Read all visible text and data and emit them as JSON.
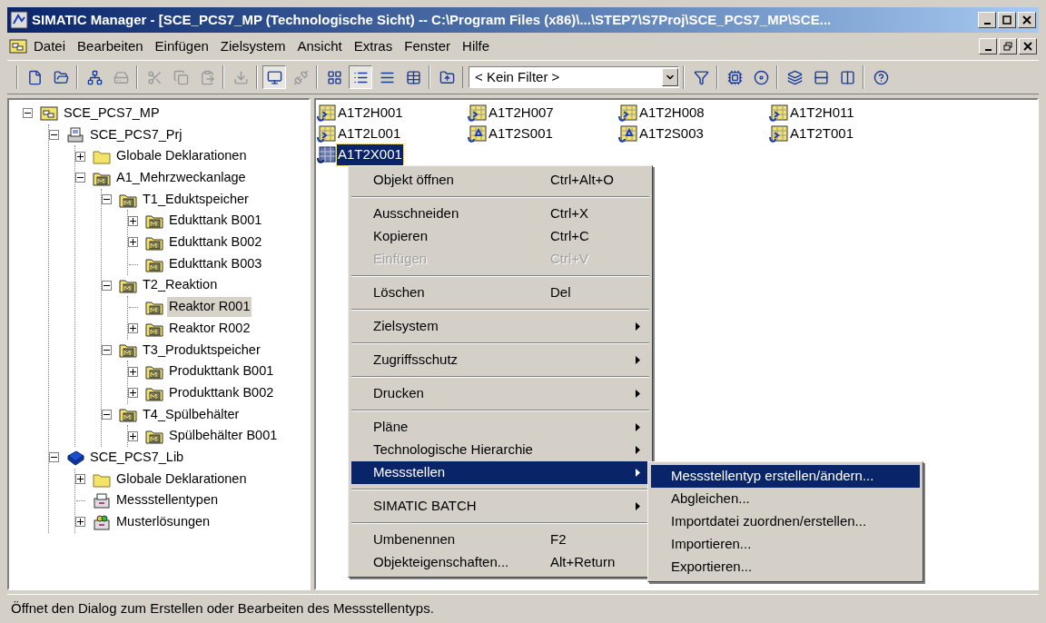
{
  "window": {
    "title": "SIMATIC Manager - [SCE_PCS7_MP (Technologische Sicht) -- C:\\Program Files (x86)\\...\\STEP7\\S7Proj\\SCE_PCS7_MP\\SCE..."
  },
  "menu_bar": {
    "items": [
      "Datei",
      "Bearbeiten",
      "Einfügen",
      "Zielsystem",
      "Ansicht",
      "Extras",
      "Fenster",
      "Hilfe"
    ]
  },
  "toolbar": {
    "groups": [
      [
        {
          "kind": "new",
          "disabled": false,
          "pressed": false
        },
        {
          "kind": "open",
          "disabled": false,
          "pressed": false
        }
      ],
      [
        {
          "kind": "network",
          "disabled": false,
          "pressed": false
        },
        {
          "kind": "hardware",
          "disabled": true,
          "pressed": false
        }
      ],
      [
        {
          "kind": "cut",
          "disabled": true,
          "pressed": false
        },
        {
          "kind": "copy",
          "disabled": true,
          "pressed": false
        },
        {
          "kind": "paste",
          "disabled": true,
          "pressed": false
        }
      ],
      [
        {
          "kind": "download",
          "disabled": true,
          "pressed": false
        }
      ],
      [
        {
          "kind": "online",
          "disabled": false,
          "pressed": true
        },
        {
          "kind": "offline",
          "disabled": true,
          "pressed": false
        }
      ],
      [
        {
          "kind": "large-icons",
          "disabled": false,
          "pressed": false
        },
        {
          "kind": "small-icons",
          "disabled": false,
          "pressed": true
        },
        {
          "kind": "list",
          "disabled": false,
          "pressed": false
        },
        {
          "kind": "details",
          "disabled": false,
          "pressed": false
        }
      ],
      [
        {
          "kind": "up",
          "disabled": false,
          "pressed": false
        }
      ]
    ],
    "filter": {
      "value": "< Kein Filter >"
    },
    "groups_right": [
      [
        {
          "kind": "filter",
          "disabled": false,
          "pressed": false
        }
      ],
      [
        {
          "kind": "accessible",
          "disabled": false,
          "pressed": false
        },
        {
          "kind": "simulation",
          "disabled": false,
          "pressed": false
        }
      ],
      [
        {
          "kind": "cascade",
          "disabled": false,
          "pressed": false
        },
        {
          "kind": "tile-h",
          "disabled": false,
          "pressed": false
        },
        {
          "kind": "tile-v",
          "disabled": false,
          "pressed": false
        }
      ],
      [
        {
          "kind": "help",
          "disabled": false,
          "pressed": false
        }
      ]
    ]
  },
  "tree": [
    {
      "label": "SCE_PCS7_MP",
      "kind": "multiproject",
      "expanded": true,
      "selected": false,
      "children": [
        {
          "label": "SCE_PCS7_Prj",
          "kind": "project",
          "expanded": true,
          "selected": false,
          "children": [
            {
              "label": "Globale Deklarationen",
              "kind": "folder",
              "expanded": false,
              "selected": false
            },
            {
              "label": "A1_Mehrzweckanlage",
              "kind": "plant",
              "expanded": true,
              "selected": false,
              "children": [
                {
                  "label": "T1_Eduktspeicher",
                  "kind": "plant",
                  "expanded": true,
                  "selected": false,
                  "children": [
                    {
                      "label": "Edukttank B001",
                      "kind": "plant",
                      "expanded": false,
                      "selected": false
                    },
                    {
                      "label": "Edukttank B002",
                      "kind": "plant",
                      "expanded": false,
                      "selected": false
                    },
                    {
                      "label": "Edukttank B003",
                      "kind": "plant",
                      "selected": false
                    }
                  ]
                },
                {
                  "label": "T2_Reaktion",
                  "kind": "plant",
                  "expanded": true,
                  "selected": false,
                  "children": [
                    {
                      "label": "Reaktor R001",
                      "kind": "plant",
                      "selected": true
                    },
                    {
                      "label": "Reaktor R002",
                      "kind": "plant",
                      "expanded": false,
                      "selected": false
                    }
                  ]
                },
                {
                  "label": "T3_Produktspeicher",
                  "kind": "plant",
                  "expanded": true,
                  "selected": false,
                  "children": [
                    {
                      "label": "Produkttank B001",
                      "kind": "plant",
                      "expanded": false,
                      "selected": false
                    },
                    {
                      "label": "Produkttank B002",
                      "kind": "plant",
                      "expanded": false,
                      "selected": false
                    }
                  ]
                },
                {
                  "label": "T4_Spülbehälter",
                  "kind": "plant",
                  "expanded": true,
                  "selected": false,
                  "children": [
                    {
                      "label": "Spülbehälter B001",
                      "kind": "plant",
                      "expanded": false,
                      "selected": false
                    }
                  ]
                }
              ]
            }
          ]
        },
        {
          "label": "SCE_PCS7_Lib",
          "kind": "library",
          "expanded": true,
          "selected": false,
          "children": [
            {
              "label": "Globale Deklarationen",
              "kind": "folder",
              "expanded": false,
              "selected": false
            },
            {
              "label": "Messstellentypen",
              "kind": "archive",
              "selected": false
            },
            {
              "label": "Musterlösungen",
              "kind": "archive-green",
              "expanded": false,
              "selected": false
            }
          ]
        }
      ]
    }
  ],
  "objects": [
    {
      "label": "A1T2H001",
      "kind": "chart",
      "selected": false
    },
    {
      "label": "A1T2H007",
      "kind": "chart",
      "selected": false
    },
    {
      "label": "A1T2H008",
      "kind": "chart",
      "selected": false
    },
    {
      "label": "A1T2H011",
      "kind": "chart",
      "selected": false
    },
    {
      "label": "A1T2L001",
      "kind": "chart",
      "selected": false
    },
    {
      "label": "A1T2S001",
      "kind": "chart-blue",
      "selected": false
    },
    {
      "label": "A1T2S003",
      "kind": "chart-blue",
      "selected": false
    },
    {
      "label": "A1T2T001",
      "kind": "chart",
      "selected": false
    },
    {
      "label": "A1T2X001",
      "kind": "type",
      "selected": true
    }
  ],
  "context_menu": {
    "sections": [
      [
        {
          "label": "Objekt öffnen",
          "shortcut": "Ctrl+Alt+O",
          "submenu": false,
          "disabled": false,
          "selected": false
        }
      ],
      [
        {
          "label": "Ausschneiden",
          "shortcut": "Ctrl+X",
          "submenu": false,
          "disabled": false,
          "selected": false
        },
        {
          "label": "Kopieren",
          "shortcut": "Ctrl+C",
          "submenu": false,
          "disabled": false,
          "selected": false
        },
        {
          "label": "Einfügen",
          "shortcut": "Ctrl+V",
          "submenu": false,
          "disabled": true,
          "selected": false
        }
      ],
      [
        {
          "label": "Löschen",
          "shortcut": "Del",
          "submenu": false,
          "disabled": false,
          "selected": false
        }
      ],
      [
        {
          "label": "Zielsystem",
          "submenu": true,
          "disabled": false,
          "selected": false
        }
      ],
      [
        {
          "label": "Zugriffsschutz",
          "submenu": true,
          "disabled": false,
          "selected": false
        }
      ],
      [
        {
          "label": "Drucken",
          "submenu": true,
          "disabled": false,
          "selected": false
        }
      ],
      [
        {
          "label": "Pläne",
          "submenu": true,
          "disabled": false,
          "selected": false
        },
        {
          "label": "Technologische Hierarchie",
          "submenu": true,
          "disabled": false,
          "selected": false
        },
        {
          "label": "Messstellen",
          "submenu": true,
          "disabled": false,
          "selected": true
        }
      ],
      [
        {
          "label": "SIMATIC BATCH",
          "submenu": true,
          "disabled": false,
          "selected": false
        }
      ],
      [
        {
          "label": "Umbenennen",
          "shortcut": "F2",
          "submenu": false,
          "disabled": false,
          "selected": false
        },
        {
          "label": "Objekteigenschaften...",
          "shortcut": "Alt+Return",
          "submenu": false,
          "disabled": false,
          "selected": false
        }
      ]
    ]
  },
  "submenu": {
    "items": [
      {
        "label": "Messstellentyp erstellen/ändern...",
        "selected": true
      },
      {
        "label": "Abgleichen...",
        "selected": false
      },
      {
        "label": "Importdatei zuordnen/erstellen...",
        "selected": false
      },
      {
        "label": "Importieren...",
        "selected": false
      },
      {
        "label": "Exportieren...",
        "selected": false
      }
    ]
  },
  "status_bar": {
    "text": "Öffnet den Dialog zum Erstellen oder Bearbeiten des Messstellentyps."
  }
}
